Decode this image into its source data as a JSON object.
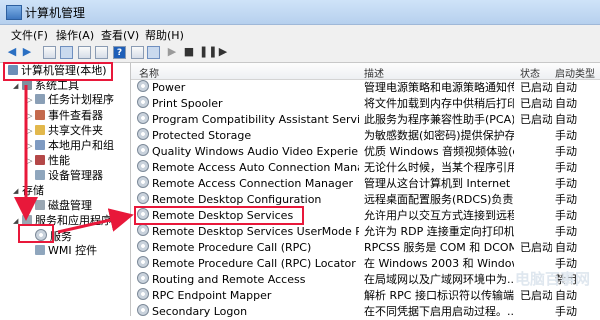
{
  "window": {
    "title": "计算机管理"
  },
  "menu": [
    "文件(F)",
    "操作(A)",
    "查看(V)",
    "帮助(H)"
  ],
  "tree": [
    {
      "label": "计算机管理(本地)"
    },
    {
      "label": "系统工具"
    },
    {
      "label": "任务计划程序"
    },
    {
      "label": "事件查看器"
    },
    {
      "label": "共享文件夹"
    },
    {
      "label": "本地用户和组"
    },
    {
      "label": "性能"
    },
    {
      "label": "设备管理器"
    },
    {
      "label": "存储"
    },
    {
      "label": "磁盘管理"
    },
    {
      "label": "服务和应用程序"
    },
    {
      "label": "服务"
    },
    {
      "label": "WMI 控件"
    }
  ],
  "columns": {
    "name": "名称",
    "desc": "描述",
    "status": "状态",
    "startup": "启动类型"
  },
  "services": [
    {
      "name": "Power",
      "desc": "管理电源策略和电源策略通知传...",
      "status": "已启动",
      "startup": "自动"
    },
    {
      "name": "Print Spooler",
      "desc": "将文件加载到内存中供稍后打印",
      "status": "已启动",
      "startup": "自动"
    },
    {
      "name": "Program Compatibility Assistant Service",
      "desc": "此服务为程序兼容性助手(PCA)...",
      "status": "已启动",
      "startup": "自动"
    },
    {
      "name": "Protected Storage",
      "desc": "为敏感数据(如密码)提供保护存...",
      "status": "",
      "startup": "手动"
    },
    {
      "name": "Quality Windows Audio Video Experience",
      "desc": "优质 Windows 音频视频体验(q...",
      "status": "",
      "startup": "手动"
    },
    {
      "name": "Remote Access Auto Connection Manager",
      "desc": "无论什么时候，当某个程序引用...",
      "status": "",
      "startup": "手动"
    },
    {
      "name": "Remote Access Connection Manager",
      "desc": "管理从这台计算机到 Internet ...",
      "status": "",
      "startup": "手动"
    },
    {
      "name": "Remote Desktop Configuration",
      "desc": "远程桌面配置服务(RDCS)负责...",
      "status": "",
      "startup": "手动"
    },
    {
      "name": "Remote Desktop Services",
      "desc": "允许用户以交互方式连接到远程...",
      "status": "",
      "startup": "手动"
    },
    {
      "name": "Remote Desktop Services UserMode Por...",
      "desc": "允许为 RDP 连接重定向打印机/...",
      "status": "",
      "startup": "手动"
    },
    {
      "name": "Remote Procedure Call (RPC)",
      "desc": "RPCSS 服务是 COM 和 DCOM...",
      "status": "已启动",
      "startup": "自动"
    },
    {
      "name": "Remote Procedure Call (RPC) Locator",
      "desc": "在 Windows 2003 和 Window...",
      "status": "",
      "startup": "手动"
    },
    {
      "name": "Routing and Remote Access",
      "desc": "在局域网以及广域网环境中为...",
      "status": "",
      "startup": "禁用"
    },
    {
      "name": "RPC Endpoint Mapper",
      "desc": "解析 RPC 接口标识符以传输端...",
      "status": "已启动",
      "startup": "自动"
    },
    {
      "name": "Secondary Logon",
      "desc": "在不同凭据下启用启动过程。...",
      "status": "",
      "startup": "手动"
    }
  ],
  "watermark": "电脑百事网",
  "colors": {
    "highlight": "#e8183a"
  }
}
